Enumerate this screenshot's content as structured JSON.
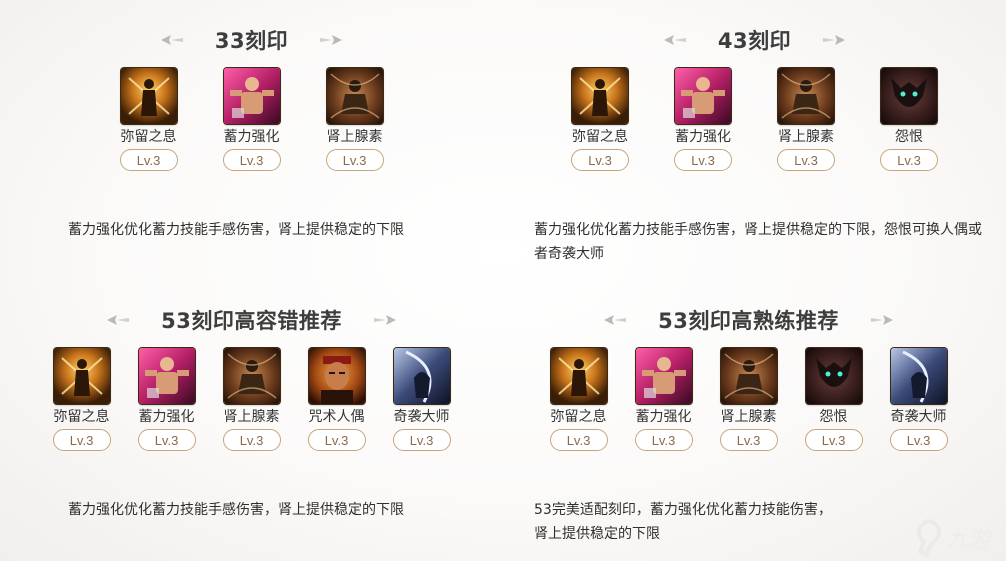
{
  "sections": [
    {
      "title": "33刻印",
      "skills": [
        {
          "name": "弥留之息",
          "level": "Lv.3",
          "icon": "dying-breath-icon"
        },
        {
          "name": "蓄力强化",
          "level": "Lv.3",
          "icon": "charge-enhance-icon"
        },
        {
          "name": "肾上腺素",
          "level": "Lv.3",
          "icon": "adrenaline-icon"
        }
      ],
      "desc": "蓄力强化优化蓄力技能手感伤害，肾上提供稳定的下限"
    },
    {
      "title": "43刻印",
      "skills": [
        {
          "name": "弥留之息",
          "level": "Lv.3",
          "icon": "dying-breath-icon"
        },
        {
          "name": "蓄力强化",
          "level": "Lv.3",
          "icon": "charge-enhance-icon"
        },
        {
          "name": "肾上腺素",
          "level": "Lv.3",
          "icon": "adrenaline-icon"
        },
        {
          "name": "怨恨",
          "level": "Lv.3",
          "icon": "grudge-icon"
        }
      ],
      "desc": "蓄力强化优化蓄力技能手感伤害，肾上提供稳定的下限，怨恨可换人偶或者奇袭大师"
    },
    {
      "title": "53刻印高容错推荐",
      "skills": [
        {
          "name": "弥留之息",
          "level": "Lv.3",
          "icon": "dying-breath-icon"
        },
        {
          "name": "蓄力强化",
          "level": "Lv.3",
          "icon": "charge-enhance-icon"
        },
        {
          "name": "肾上腺素",
          "level": "Lv.3",
          "icon": "adrenaline-icon"
        },
        {
          "name": "咒术人偶",
          "level": "Lv.3",
          "icon": "cursed-doll-icon"
        },
        {
          "name": "奇袭大师",
          "level": "Lv.3",
          "icon": "ambush-master-icon"
        }
      ],
      "desc": "蓄力强化优化蓄力技能手感伤害，肾上提供稳定的下限"
    },
    {
      "title": "53刻印高熟练推荐",
      "skills": [
        {
          "name": "弥留之息",
          "level": "Lv.3",
          "icon": "dying-breath-icon"
        },
        {
          "name": "蓄力强化",
          "level": "Lv.3",
          "icon": "charge-enhance-icon"
        },
        {
          "name": "肾上腺素",
          "level": "Lv.3",
          "icon": "adrenaline-icon"
        },
        {
          "name": "怨恨",
          "level": "Lv.3",
          "icon": "grudge-icon"
        },
        {
          "name": "奇袭大师",
          "level": "Lv.3",
          "icon": "ambush-master-icon"
        }
      ],
      "desc": "53完美适配刻印，蓄力强化优化蓄力技能伤害，肾上提供稳定的下限"
    }
  ],
  "watermark": {
    "text": "九游"
  }
}
